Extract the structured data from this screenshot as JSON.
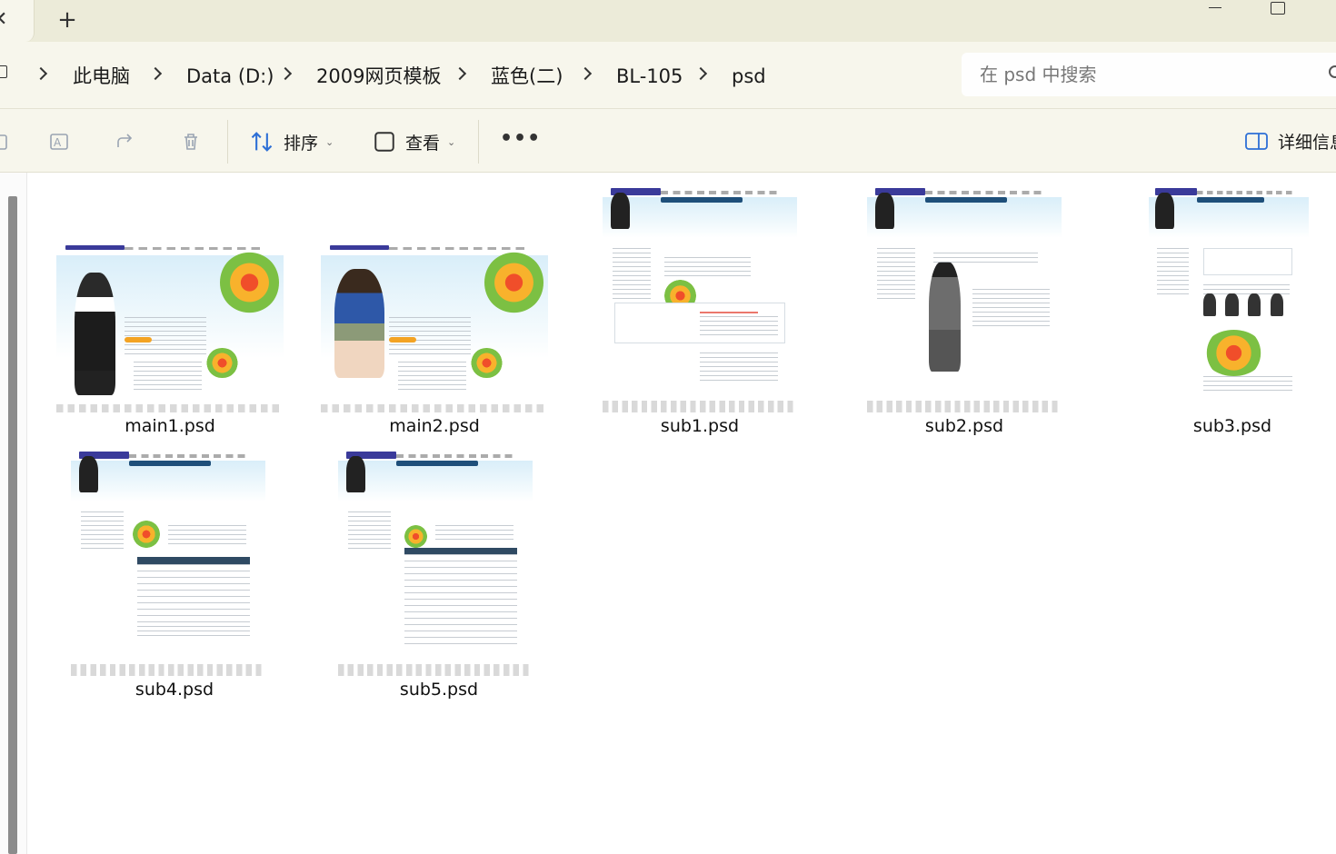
{
  "titlebar": {
    "tab_close_glyph": "✕",
    "new_tab_glyph": "+"
  },
  "breadcrumb": {
    "items": [
      "此电脑",
      "Data (D:)",
      "2009网页模板",
      "蓝色(二)",
      "BL-105",
      "psd"
    ]
  },
  "search": {
    "placeholder": "在 psd 中搜索"
  },
  "toolbar": {
    "sort_label": "排序",
    "view_label": "查看",
    "more_label": "•••",
    "details_label": "详细信息"
  },
  "files": [
    {
      "name": "main1.psd"
    },
    {
      "name": "main2.psd"
    },
    {
      "name": "sub1.psd"
    },
    {
      "name": "sub2.psd"
    },
    {
      "name": "sub3.psd"
    },
    {
      "name": "sub4.psd"
    },
    {
      "name": "sub5.psd"
    }
  ],
  "colors": {
    "chrome_bg": "#f7f6ec",
    "titlebar_bg": "#ecebd9",
    "accent_icon": "#2d6fd6"
  }
}
